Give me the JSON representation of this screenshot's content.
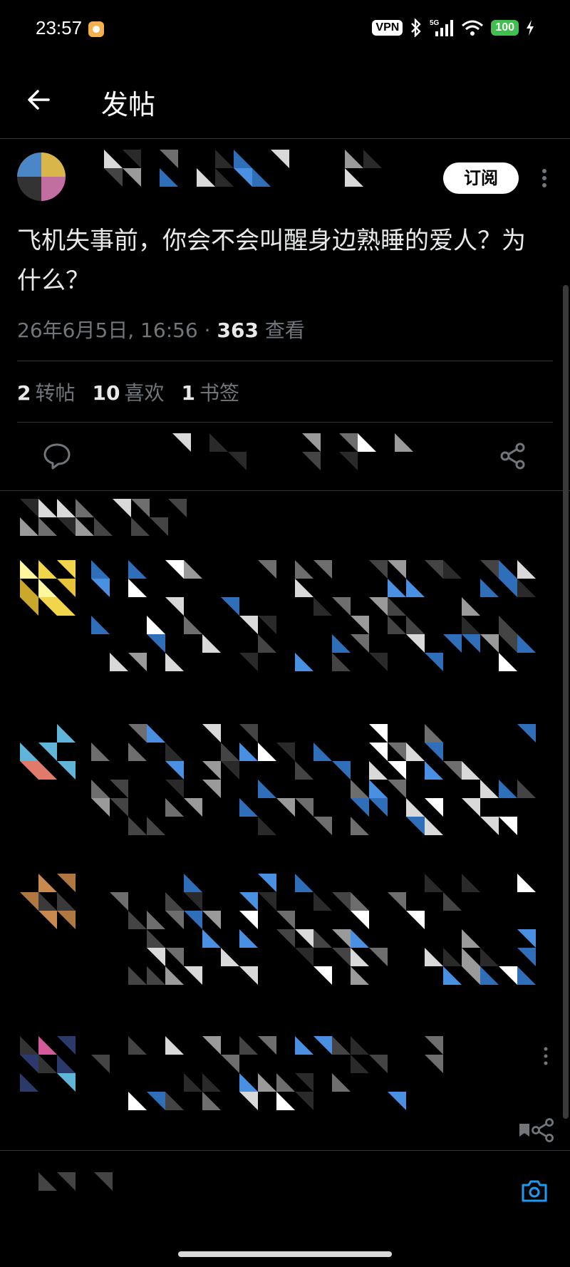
{
  "status_bar": {
    "time": "23:57",
    "vpn": "VPN",
    "network": "5G",
    "battery": "100"
  },
  "header": {
    "title": "发帖",
    "back_icon": "arrow-left-icon"
  },
  "post": {
    "subscribe_label": "订阅",
    "text": "飞机失事前，你会不会叫醒身边熟睡的爱人？为什么？",
    "date": "26年6月5日, 16:56",
    "separator": "·",
    "views_count": "363",
    "views_label": "查看",
    "stats": {
      "reposts_count": "2",
      "reposts_label": "转帖",
      "likes_count": "10",
      "likes_label": "喜欢",
      "bookmarks_count": "1",
      "bookmarks_label": "书签"
    },
    "actions": [
      "reply-icon",
      "repost-icon",
      "like-icon",
      "bookmark-icon",
      "share-icon"
    ]
  },
  "colors": {
    "background": "#000000",
    "text": "#e7e9ea",
    "muted": "#71767b",
    "divider": "#2f3336",
    "accent": "#1d9bf0"
  }
}
